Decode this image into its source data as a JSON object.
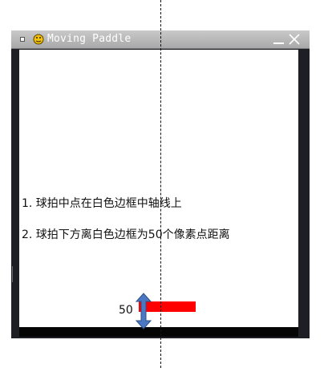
{
  "window": {
    "title": "Moving Paddle",
    "icons": {
      "menu": "window-menu-icon",
      "app": "pygame-snake-icon",
      "minimize": "minimize-icon",
      "close": "close-icon"
    }
  },
  "game": {
    "background_color": "#ffffff",
    "border_color": "#000000",
    "paddle_color": "#ff0000"
  },
  "annotations": {
    "note_1": "1. 球拍中点在白色边框中轴线上",
    "note_2": "2. 球拍下方离白色边框为50个像素点距离",
    "distance_label": "50",
    "arrow_color": "#4a78c2"
  }
}
